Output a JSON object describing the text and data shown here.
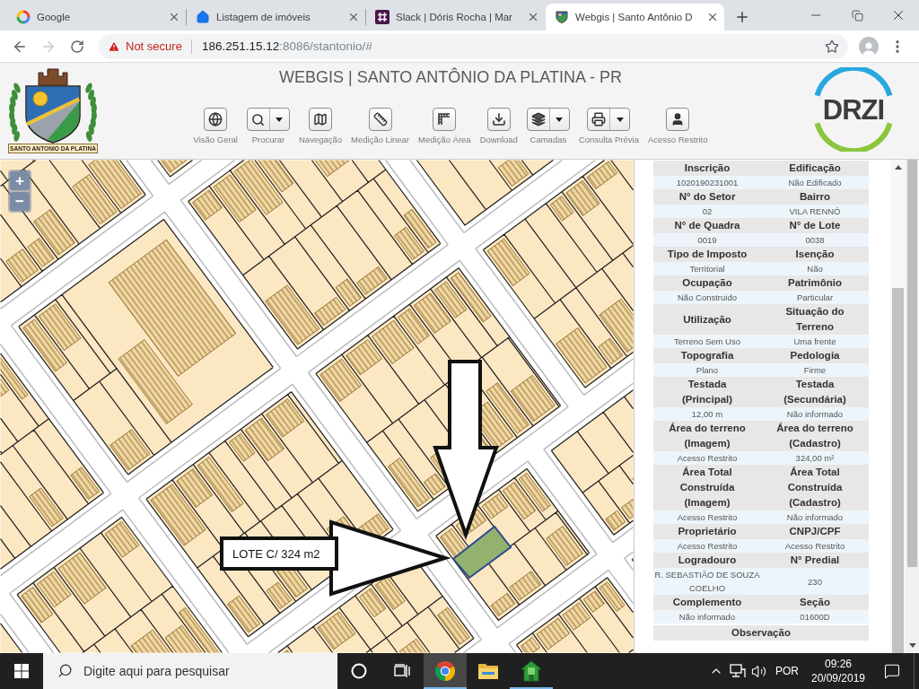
{
  "browser": {
    "tabs": [
      {
        "title": "Google",
        "selected": false
      },
      {
        "title": "Listagem de imóveis",
        "selected": false
      },
      {
        "title": "Slack | Dóris Rocha | Mar",
        "selected": false
      },
      {
        "title": "Webgis | Santo Antônio D",
        "selected": true
      }
    ],
    "forward_disabled": true,
    "address": {
      "security": "Not secure",
      "host": "186.251.15.12",
      "path": ":8086/stantonio/#"
    }
  },
  "header": {
    "crest_motto": "SANTO ANTONIO DA PLATINA",
    "title": "WEBGIS | SANTO ANTÔNIO DA PLATINA - PR",
    "brand": "DRZI",
    "tools": [
      {
        "label": "Visão Geral",
        "dropdown": false
      },
      {
        "label": "Procurar",
        "dropdown": true
      },
      {
        "label": "Navegação",
        "dropdown": false
      },
      {
        "label": "Medição Linear",
        "dropdown": false
      },
      {
        "label": "Medição Área",
        "dropdown": false
      },
      {
        "label": "Download",
        "dropdown": false
      },
      {
        "label": "Camadas",
        "dropdown": true
      },
      {
        "label": "Consulta Prévia",
        "dropdown": true
      },
      {
        "label": "Acesso Restrito",
        "dropdown": false
      }
    ]
  },
  "map": {
    "zoom_in": "+",
    "zoom_out": "−",
    "annotation": "LOTE C/ 324 m2"
  },
  "details": {
    "rows": [
      {
        "fields": [
          {
            "label": "Inscrição",
            "value": "1020190231001"
          },
          {
            "label": "Edificação",
            "value": "Não Edificado"
          }
        ]
      },
      {
        "fields": [
          {
            "label": "N° do Setor",
            "value": "02"
          },
          {
            "label": "Bairro",
            "value": "VILA RENNÓ"
          }
        ]
      },
      {
        "fields": [
          {
            "label": "N° de Quadra",
            "value": "0019"
          },
          {
            "label": "N° de Lote",
            "value": "0038"
          }
        ]
      },
      {
        "fields": [
          {
            "label": "Tipo de Imposto",
            "value": "Territorial"
          },
          {
            "label": "Isenção",
            "value": "Não"
          }
        ]
      },
      {
        "fields": [
          {
            "label": "Ocupação",
            "value": "Não Construido"
          },
          {
            "label": "Patrimônio",
            "value": "Particular"
          }
        ]
      },
      {
        "fields": [
          {
            "label": "Utilização",
            "value": "Terreno Sem Uso"
          },
          {
            "label": "Situação do Terreno",
            "value": "Uma frente"
          }
        ]
      },
      {
        "fields": [
          {
            "label": "Topografia",
            "value": "Plano"
          },
          {
            "label": "Pedologia",
            "value": "Firme"
          }
        ]
      },
      {
        "fields": [
          {
            "label": "Testada (Principal)",
            "value": "12,00 m"
          },
          {
            "label": "Testada (Secundária)",
            "value": "Não informado"
          }
        ]
      },
      {
        "fields": [
          {
            "label": "Área do terreno (Imagem)",
            "value": "Acesso Restrito"
          },
          {
            "label": "Área do terreno (Cadastro)",
            "value": "324,00 m²"
          }
        ]
      },
      {
        "fields": [
          {
            "label": "Área Total Construída (Imagem)",
            "value": "Acesso Restrito"
          },
          {
            "label": "Área Total Construída (Cadastro)",
            "value": "Não informado"
          }
        ]
      },
      {
        "fields": [
          {
            "label": "Proprietário",
            "value": "Acesso Restrito"
          },
          {
            "label": "CNPJ/CPF",
            "value": "Acesso Restrito"
          }
        ]
      },
      {
        "fields": [
          {
            "label": "Logradouro",
            "value": "R. SEBASTIÃO DE SOUZA COELHO"
          },
          {
            "label": "N° Predial",
            "value": "230"
          }
        ]
      },
      {
        "fields": [
          {
            "label": "Complemento",
            "value": "Não informado"
          },
          {
            "label": "Seção",
            "value": "01600D"
          }
        ]
      }
    ],
    "section": "Observação"
  },
  "taskbar": {
    "search": {
      "placeholder": "Digite aqui para pesquisar"
    },
    "apps": [
      {
        "selected": true,
        "running": true
      },
      {
        "selected": false,
        "running": false
      },
      {
        "selected": false,
        "running": true
      }
    ],
    "language": "POR",
    "time": "09:26",
    "date": "20/09/2019"
  }
}
